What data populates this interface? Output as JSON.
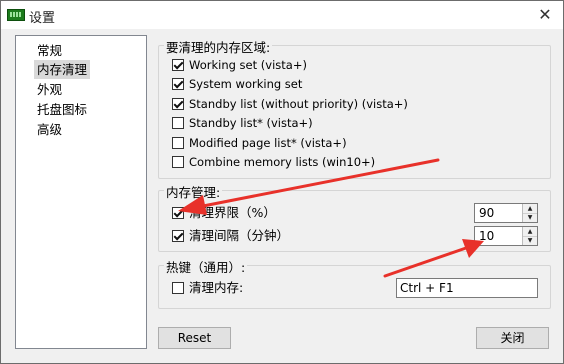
{
  "window": {
    "title": "设置",
    "close_glyph": "✕"
  },
  "nav": {
    "items": [
      {
        "label": "常规"
      },
      {
        "label": "内存清理",
        "selected": true
      },
      {
        "label": "外观"
      },
      {
        "label": "托盘图标"
      },
      {
        "label": "高级"
      }
    ]
  },
  "memory_areas": {
    "title": "要清理的内存区域:",
    "options": [
      {
        "label": "Working set (vista+)",
        "checked": true
      },
      {
        "label": "System working set",
        "checked": true
      },
      {
        "label": "Standby list (without priority) (vista+)",
        "checked": true
      },
      {
        "label": "Standby list* (vista+)",
        "checked": false
      },
      {
        "label": "Modified page list* (vista+)",
        "checked": false
      },
      {
        "label": "Combine memory lists (win10+)",
        "checked": false
      }
    ]
  },
  "memory_management": {
    "title": "内存管理:",
    "threshold": {
      "label": "清理界限（%）",
      "checked": true,
      "value": "90"
    },
    "interval": {
      "label": "清理间隔（分钟）",
      "checked": true,
      "value": "10"
    }
  },
  "hotkey": {
    "title": "热键（通用）:",
    "clean_memory": {
      "label": "清理内存:",
      "checked": false
    },
    "value": "Ctrl + F1"
  },
  "buttons": {
    "reset": "Reset",
    "close": "关闭"
  },
  "annotation": {
    "arrow_color": "#e8312a"
  },
  "spin_glyphs": {
    "up": "▲",
    "down": "▼"
  }
}
